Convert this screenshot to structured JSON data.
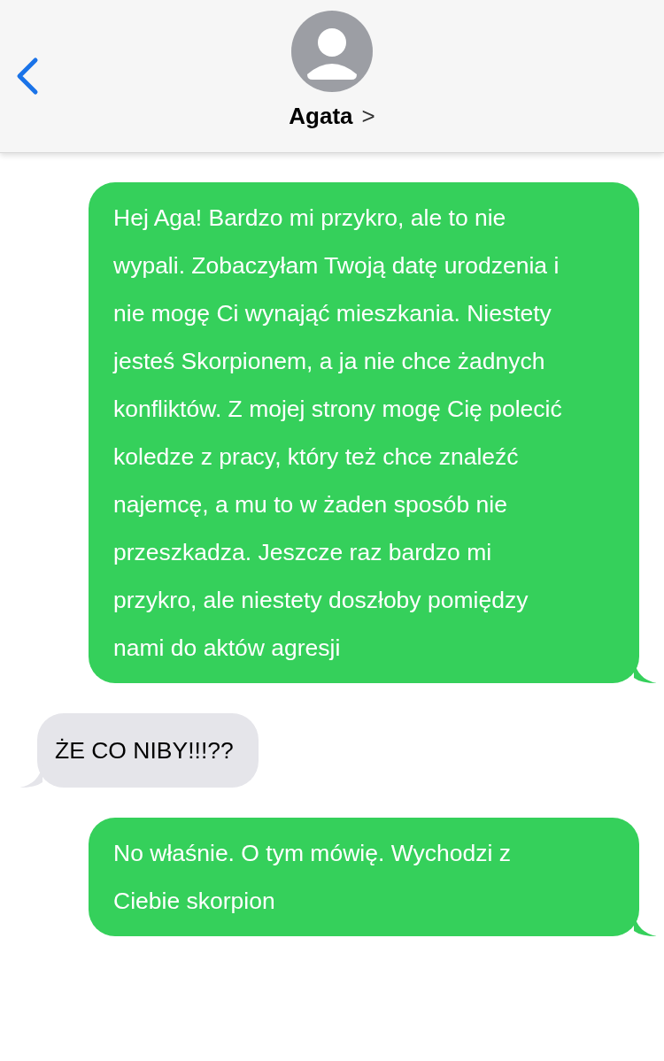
{
  "header": {
    "contact_name": "Agata",
    "name_chevron": ">"
  },
  "messages": [
    {
      "kind": "outgoing",
      "text": "Hej Aga! Bardzo mi przykro, ale to nie wypali. Zobaczyłam Twoją datę urodzenia i nie mogę Ci wynająć mieszkania. Niestety jesteś Skorpionem, a ja nie chce żadnych konfliktów. Z mojej strony mogę Cię polecić koledze z pracy, który też chce znaleźć najemcę, a mu to w żaden sposób nie przeszkadza. Jeszcze raz bardzo mi przykro, ale niestety doszłoby pomiędzy nami do aktów agresji"
    },
    {
      "kind": "incoming",
      "text": "ŻE CO NIBY!!!??"
    },
    {
      "kind": "outgoing",
      "text": "No właśnie. O tym mówię. Wychodzi z Ciebie skorpion"
    }
  ]
}
